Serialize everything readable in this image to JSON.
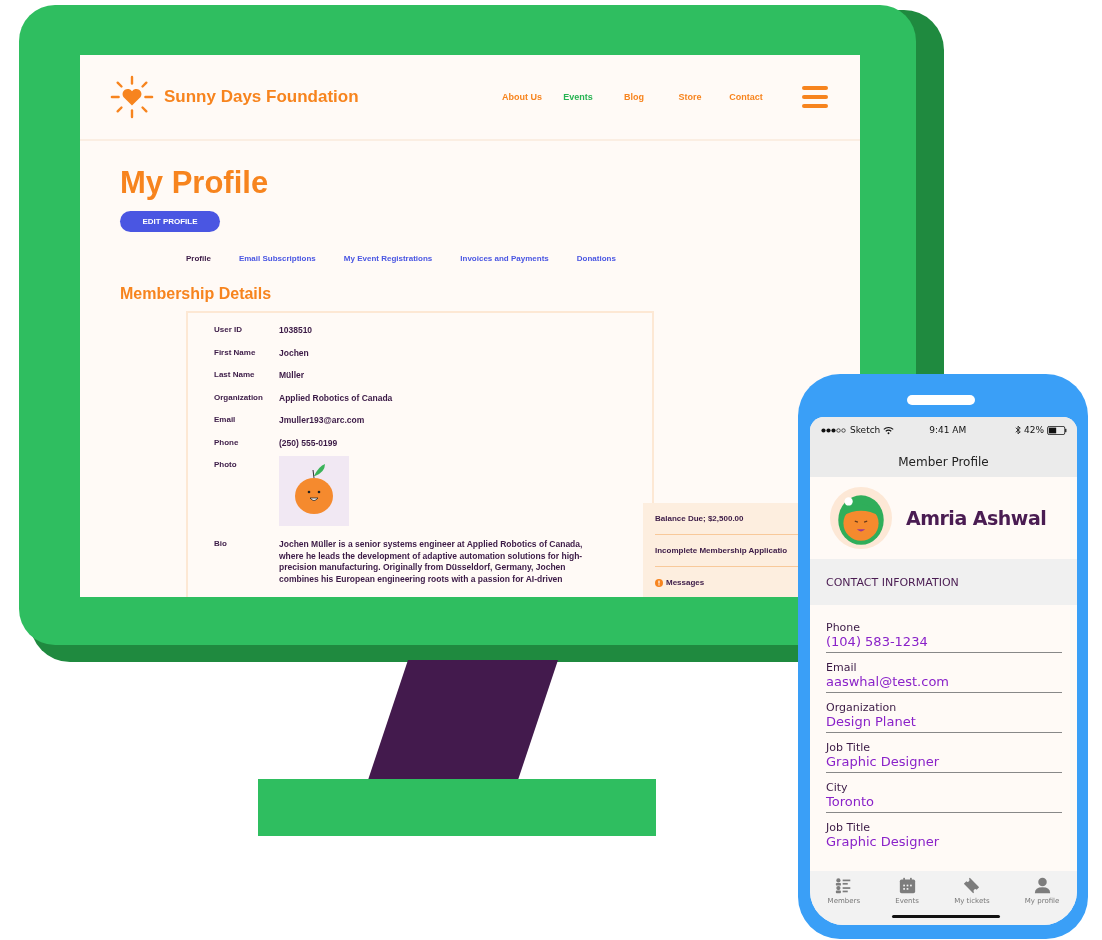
{
  "website": {
    "logo": "Sunny Days Foundation",
    "nav": [
      {
        "label": "About Us",
        "selected": false
      },
      {
        "label": "Events",
        "selected": true
      },
      {
        "label": "Blog",
        "selected": false
      },
      {
        "label": "Store",
        "selected": false
      },
      {
        "label": "Contact",
        "selected": false
      }
    ],
    "title": "My Profile",
    "edit_button": "EDIT PROFILE",
    "tabs": [
      {
        "label": "Profile",
        "selected": true
      },
      {
        "label": "Email Subscriptions",
        "selected": false
      },
      {
        "label": "My Event Registrations",
        "selected": false
      },
      {
        "label": "Invoices and Payments",
        "selected": false
      },
      {
        "label": "Donations",
        "selected": false
      }
    ],
    "section_title": "Membership Details",
    "fields": [
      {
        "kind": "text",
        "label": "User ID",
        "value": "1038510"
      },
      {
        "kind": "text",
        "label": "First Name",
        "value": "Jochen"
      },
      {
        "kind": "text",
        "label": "Last Name",
        "value": "Müller"
      },
      {
        "kind": "text",
        "label": "Organization",
        "value": "Applied Robotics of Canada"
      },
      {
        "kind": "text",
        "label": "Email",
        "value": "Jmuller193@arc.com"
      },
      {
        "kind": "text",
        "label": "Phone",
        "value": "(250) 555-0199"
      },
      {
        "kind": "photo",
        "label": "Photo"
      },
      {
        "kind": "text",
        "label": "Bio",
        "value": "Jochen Müller is a senior systems engineer at Applied Robotics of Canada, where he leads the development of adaptive automation solutions for high-precision manufacturing. Originally from Düsseldorf, Germany, Jochen combines his European engineering roots with a passion for AI-driven"
      }
    ],
    "side_panel": [
      {
        "kind": "plain",
        "text": "Balance Due; $2,500.00"
      },
      {
        "kind": "plain",
        "text": "Incomplete Membership Applicatio"
      },
      {
        "kind": "alert",
        "text": "Messages"
      }
    ]
  },
  "phone": {
    "status_bar": {
      "carrier": "Sketch",
      "time": "9:41 AM",
      "battery": "42%"
    },
    "title": "Member Profile",
    "name": "Amria Ashwal",
    "section": "CONTACT INFORMATION",
    "fields": [
      {
        "label": "Phone",
        "value": "(104) 583-1234"
      },
      {
        "label": "Email",
        "value": "aaswhal@test.com"
      },
      {
        "label": "Organization",
        "value": "Design Planet"
      },
      {
        "label": "Job Title",
        "value": "Graphic Designer"
      },
      {
        "label": "City",
        "value": "Toronto"
      },
      {
        "label": "Job Title",
        "value": "Graphic Designer"
      }
    ],
    "tab_bar": [
      {
        "kind": "members",
        "label": "Members"
      },
      {
        "kind": "events",
        "label": "Events"
      },
      {
        "kind": "tickets",
        "label": "My tickets"
      },
      {
        "kind": "profile",
        "label": "My profile"
      }
    ]
  }
}
